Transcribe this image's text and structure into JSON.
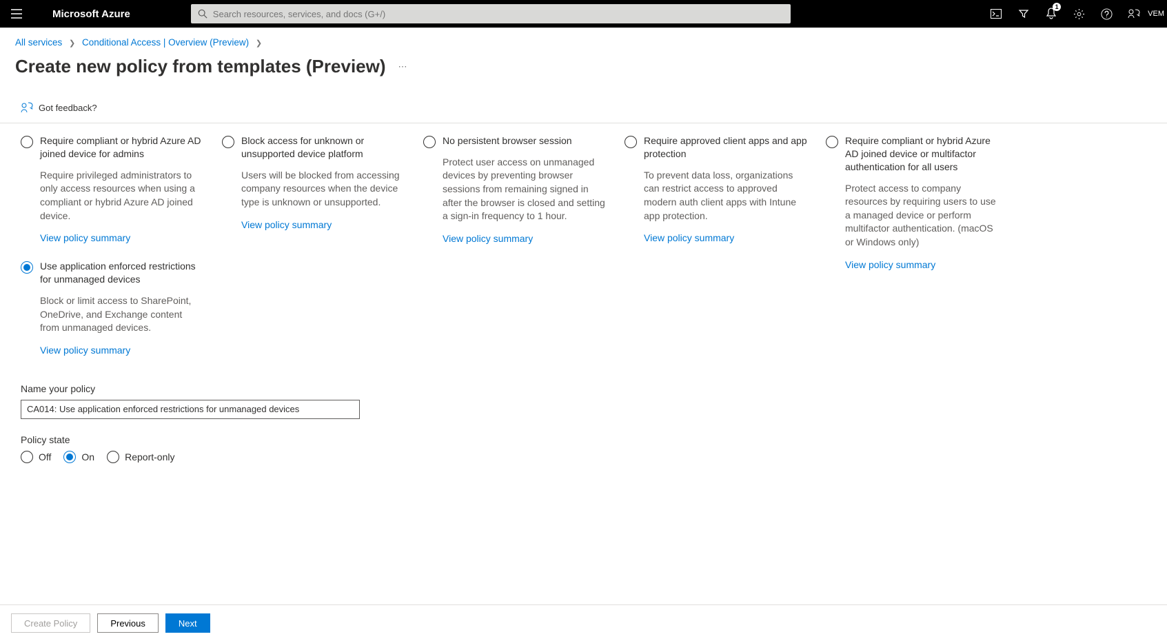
{
  "header": {
    "brand": "Microsoft Azure",
    "search_placeholder": "Search resources, services, and docs (G+/)",
    "notification_count": "1",
    "tenant": "VEM"
  },
  "breadcrumb": {
    "items": [
      "All services",
      "Conditional Access | Overview (Preview)"
    ]
  },
  "page": {
    "title": "Create new policy from templates (Preview)"
  },
  "feedback": {
    "text": "Got feedback?"
  },
  "templates": {
    "view_link_label": "View policy summary",
    "col1": [
      {
        "title": "Require compliant or hybrid Azure AD joined device for admins",
        "desc": "Require privileged administrators to only access resources when using a compliant or hybrid Azure AD joined device.",
        "selected": false
      },
      {
        "title": "Use application enforced restrictions for unmanaged devices",
        "desc": "Block or limit access to SharePoint, OneDrive, and Exchange content from unmanaged devices.",
        "selected": true
      }
    ],
    "col2": [
      {
        "title": "Block access for unknown or unsupported device platform",
        "desc": "Users will be blocked from accessing company resources when the device type is unknown or unsupported.",
        "selected": false
      }
    ],
    "col3": [
      {
        "title": "No persistent browser session",
        "desc": "Protect user access on unmanaged devices by preventing browser sessions from remaining signed in after the browser is closed and setting a sign-in frequency to 1 hour.",
        "selected": false
      }
    ],
    "col4": [
      {
        "title": "Require approved client apps and app protection",
        "desc": "To prevent data loss, organizations can restrict access to approved modern auth client apps with Intune app protection.",
        "selected": false
      }
    ],
    "col5": [
      {
        "title": "Require compliant or hybrid Azure AD joined device or multifactor authentication for all users",
        "desc": "Protect access to company resources by requiring users to use a managed device or perform multifactor authentication. (macOS or Windows only)",
        "selected": false
      }
    ]
  },
  "form": {
    "name_label": "Name your policy",
    "name_value": "CA014: Use application enforced restrictions for unmanaged devices",
    "policy_state_label": "Policy state",
    "state_options": {
      "off": "Off",
      "on": "On",
      "report": "Report-only"
    },
    "selected_state": "on"
  },
  "footer": {
    "create": "Create Policy",
    "previous": "Previous",
    "next": "Next"
  }
}
